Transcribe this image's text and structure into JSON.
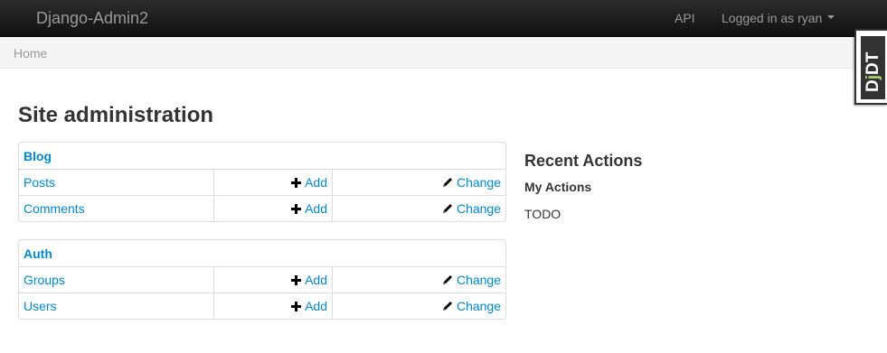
{
  "navbar": {
    "brand": "Django-Admin2",
    "api_link": "API",
    "user_menu": "Logged in as ryan"
  },
  "breadcrumb": {
    "home": "Home"
  },
  "debug_toolbar": {
    "label": "DjDT"
  },
  "page": {
    "title": "Site administration"
  },
  "apps": [
    {
      "name": "Blog",
      "models": [
        {
          "name": "Posts",
          "add": "Add",
          "change": "Change"
        },
        {
          "name": "Comments",
          "add": "Add",
          "change": "Change"
        }
      ]
    },
    {
      "name": "Auth",
      "models": [
        {
          "name": "Groups",
          "add": "Add",
          "change": "Change"
        },
        {
          "name": "Users",
          "add": "Add",
          "change": "Change"
        }
      ]
    }
  ],
  "recent_actions": {
    "title": "Recent Actions",
    "subtitle": "My Actions",
    "content": "TODO"
  },
  "colors": {
    "link": "#0088cc",
    "navbar": "#1b1b1b",
    "breadcrumb_bg": "#f5f5f5"
  },
  "icons": {
    "add": "plus-icon",
    "change": "pencil-icon",
    "user_menu": "caret-down-icon"
  }
}
